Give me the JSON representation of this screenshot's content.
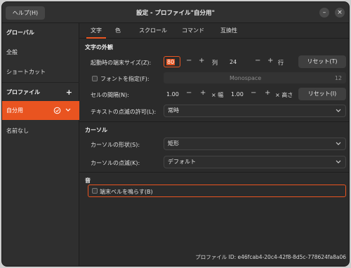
{
  "window": {
    "title": "設定 - プロファイル\"自分用\"",
    "help_label": "ヘルプ(H)",
    "minimize_glyph": "–",
    "close_glyph": "×"
  },
  "sidebar": {
    "global_header": "グローバル",
    "general": "全般",
    "shortcuts": "ショートカット",
    "profiles_header": "プロファイル",
    "add_glyph": "+",
    "profiles": [
      "自分用",
      "名前なし"
    ]
  },
  "tabs": [
    "文字",
    "色",
    "スクロール",
    "コマンド",
    "互換性"
  ],
  "text_appearance": {
    "section": "文字の外観",
    "terminal_size_label": "起動時の端末サイズ(Z):",
    "columns": "80",
    "columns_unit": "列",
    "rows": "24",
    "rows_unit": "行",
    "reset1": "リセット(T)",
    "custom_font_label": "フォントを指定(F):",
    "font_name": "Monospace",
    "font_size": "12",
    "cell_spacing_label": "セルの間隔(N):",
    "width_value": "1.00",
    "width_unit": "× 幅",
    "height_value": "1.00",
    "height_unit": "× 高さ",
    "reset2": "リセット(I)",
    "blink_label": "テキストの点滅の許可(L):",
    "blink_value": "常時",
    "minus": "−",
    "plus": "+"
  },
  "cursor": {
    "section": "カーソル",
    "shape_label": "カーソルの形状(S):",
    "shape_value": "矩形",
    "blink_label": "カーソルの点滅(K):",
    "blink_value": "デフォルト"
  },
  "sound": {
    "section": "音",
    "bell_label": "端末ベルを鳴らす(B)"
  },
  "footer": {
    "profile_id": "プロファイル ID: e46fcab4-20c4-42f8-8d5c-778624fa8a06"
  },
  "colors": {
    "accent": "#e95420",
    "window_bg": "#2b2b2b",
    "sidebar_bg": "#2f2f2f"
  },
  "icons": {
    "profile_default": "check-circle-icon",
    "profile_menu": "chevron-down-icon",
    "dropdown": "chevron-down-icon"
  }
}
